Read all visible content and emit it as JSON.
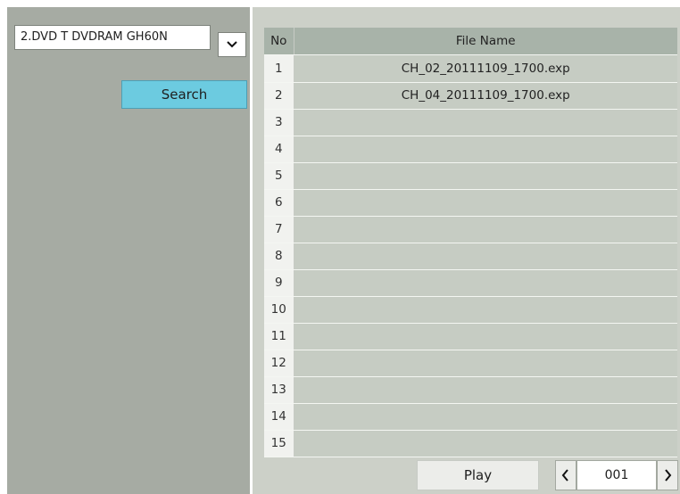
{
  "device_select": {
    "value": "2.DVD T DVDRAM GH60N",
    "icon": "chevron-down-icon"
  },
  "search_button": {
    "label": "Search"
  },
  "table": {
    "headers": [
      "No",
      "File Name"
    ],
    "rows": [
      {
        "no": "1",
        "name": "CH_02_20111109_1700.exp"
      },
      {
        "no": "2",
        "name": "CH_04_20111109_1700.exp"
      },
      {
        "no": "3",
        "name": ""
      },
      {
        "no": "4",
        "name": ""
      },
      {
        "no": "5",
        "name": ""
      },
      {
        "no": "6",
        "name": ""
      },
      {
        "no": "7",
        "name": ""
      },
      {
        "no": "8",
        "name": ""
      },
      {
        "no": "9",
        "name": ""
      },
      {
        "no": "10",
        "name": ""
      },
      {
        "no": "11",
        "name": ""
      },
      {
        "no": "12",
        "name": ""
      },
      {
        "no": "13",
        "name": ""
      },
      {
        "no": "14",
        "name": ""
      },
      {
        "no": "15",
        "name": ""
      }
    ]
  },
  "play_button": {
    "label": "Play"
  },
  "pager": {
    "page": "001",
    "prev_icon": "chevron-left-icon",
    "next_icon": "chevron-right-icon"
  },
  "colors": {
    "left_panel": "#a6aba3",
    "right_panel": "#ccd0c8",
    "search_button": "#6ccbe0",
    "header": "#a8b3a9"
  }
}
